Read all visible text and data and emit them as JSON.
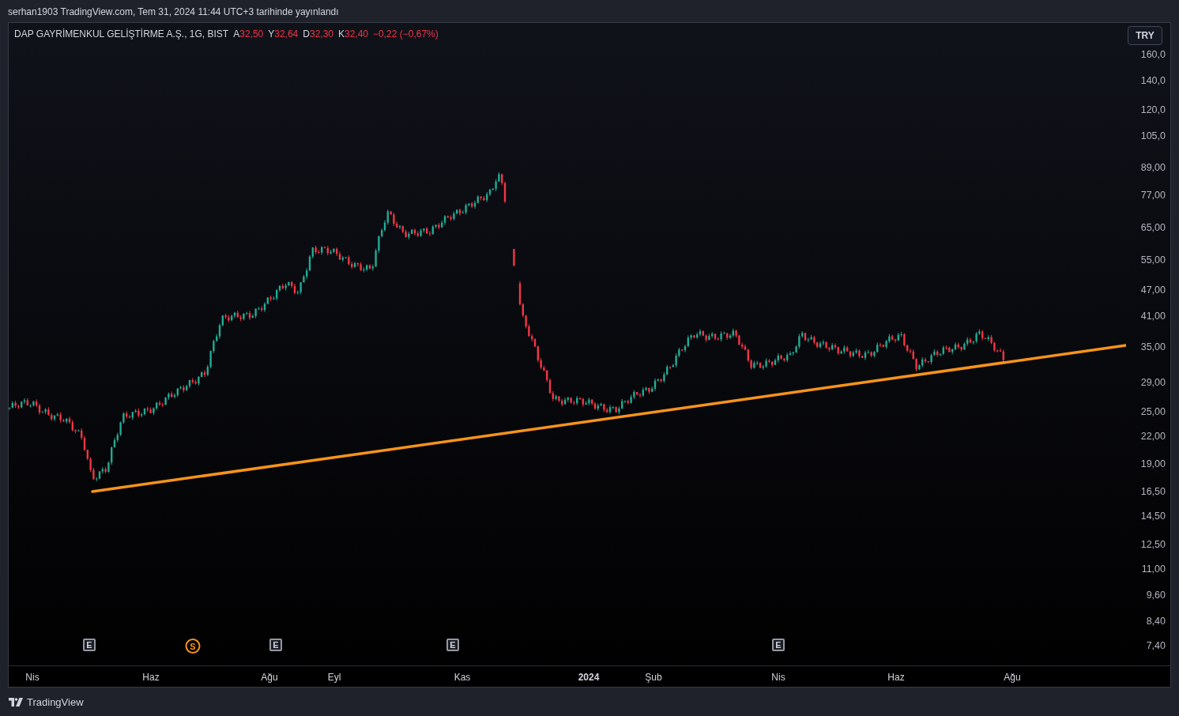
{
  "publish_line": "serhan1903 TradingView.com, Tem 31, 2024 11:44 UTC+3 tarihinde yayınlandı",
  "legend": {
    "symbol": "DAP GAYRİMENKUL GELİŞTİRME A.Ş., 1G, BIST",
    "ohlc": [
      {
        "label": "A",
        "value": "32,50"
      },
      {
        "label": "Y",
        "value": "32,64"
      },
      {
        "label": "D",
        "value": "32,30"
      },
      {
        "label": "K",
        "value": "32,40"
      }
    ],
    "change": "−0,22 (−0,67%)"
  },
  "currency_button": "TRY",
  "price_axis": [
    "160,0",
    "140,0",
    "120,0",
    "105,0",
    "89,00",
    "77,00",
    "65,00",
    "55,00",
    "47,00",
    "41,00",
    "35,00",
    "29,00",
    "25,00",
    "22,00",
    "19,00",
    "16,50",
    "14,50",
    "12,50",
    "11,00",
    "9,60",
    "8,40",
    "7,40"
  ],
  "time_axis": [
    {
      "label": "Nis",
      "kind": "month"
    },
    {
      "label": "Haz",
      "kind": "month"
    },
    {
      "label": "Ağu",
      "kind": "month"
    },
    {
      "label": "Eyl",
      "kind": "month"
    },
    {
      "label": "Kas",
      "kind": "month"
    },
    {
      "label": "2024",
      "kind": "year"
    },
    {
      "label": "Şub",
      "kind": "month"
    },
    {
      "label": "Nis",
      "kind": "month"
    },
    {
      "label": "Haz",
      "kind": "month"
    },
    {
      "label": "Ağu",
      "kind": "month"
    }
  ],
  "events": [
    {
      "kind": "earnings",
      "letter": "E"
    },
    {
      "kind": "split",
      "letter": "S"
    },
    {
      "kind": "earnings",
      "letter": "E"
    },
    {
      "kind": "earnings",
      "letter": "E"
    },
    {
      "kind": "earnings",
      "letter": "E"
    }
  ],
  "footer": {
    "brand": "TradingView"
  }
}
